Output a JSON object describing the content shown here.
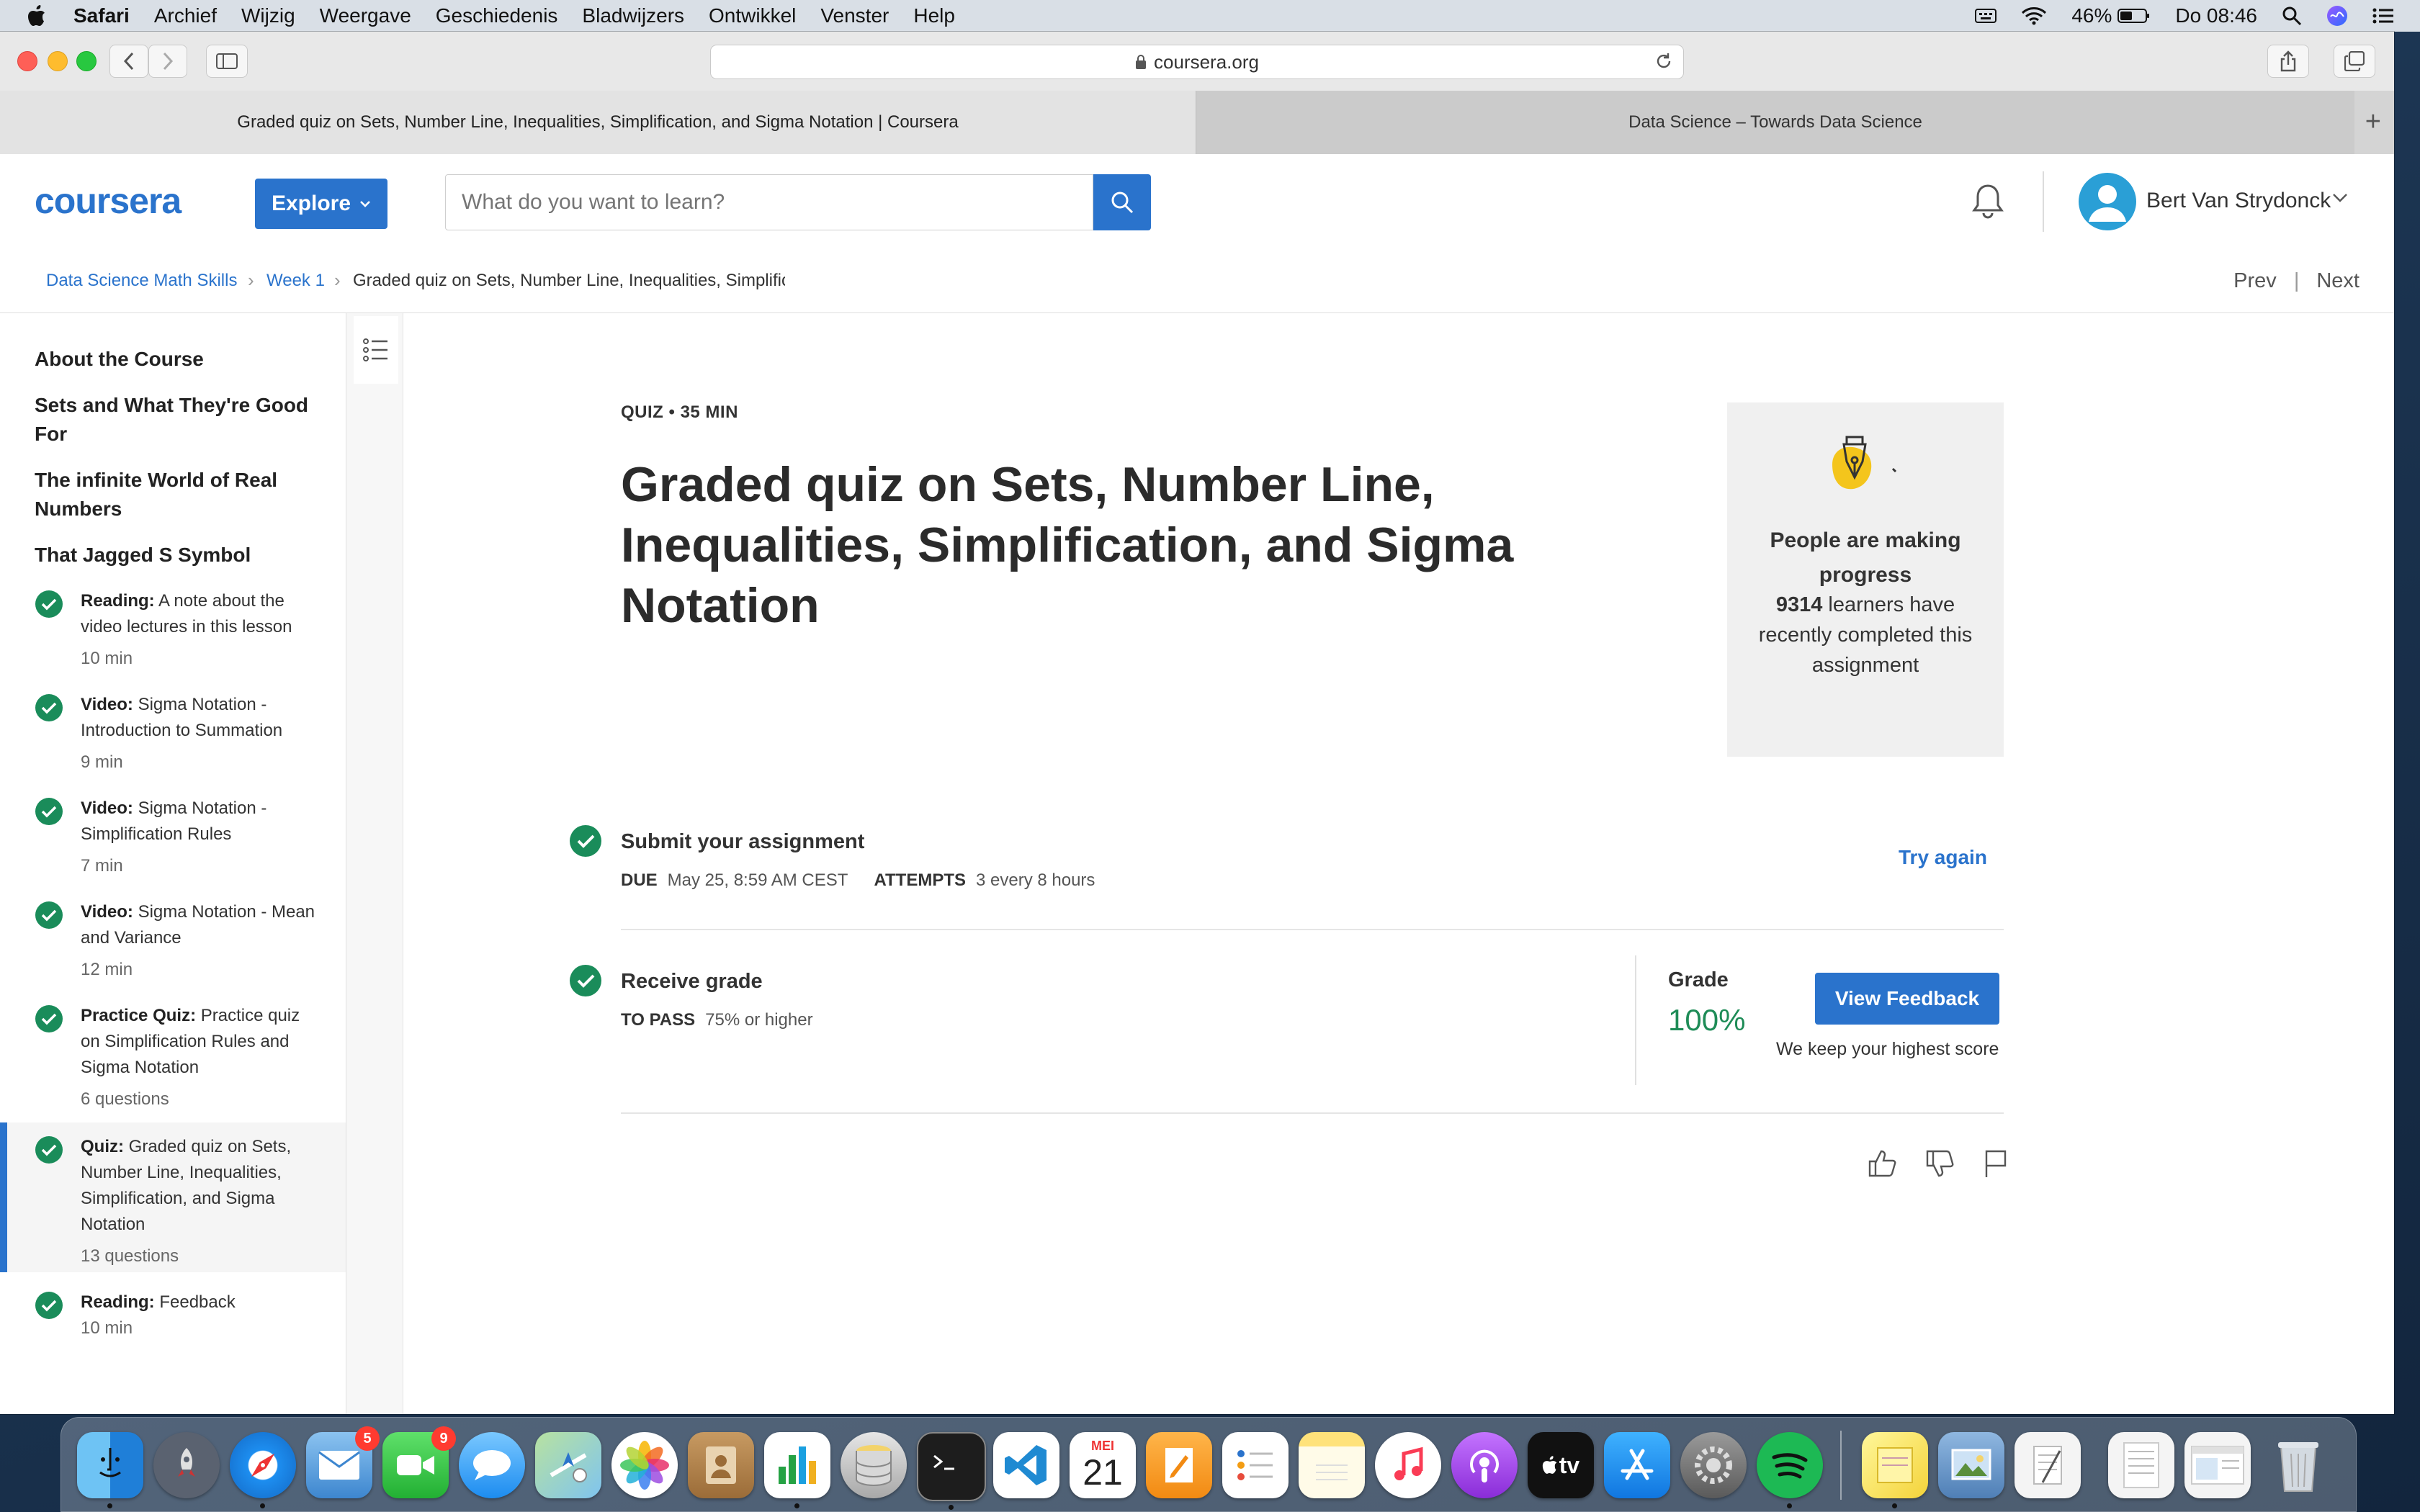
{
  "menubar": {
    "items": [
      "Safari",
      "Archief",
      "Wijzig",
      "Weergave",
      "Geschiedenis",
      "Bladwijzers",
      "Ontwikkel",
      "Venster",
      "Help"
    ],
    "battery": "46%",
    "clock": "Do 08:46"
  },
  "browser": {
    "url": "coursera.org",
    "tabs": [
      {
        "title": "Graded quiz on Sets, Number Line, Inequalities, Simplification, and Sigma Notation | Coursera",
        "active": true
      },
      {
        "title": "Data Science – Towards Data Science",
        "active": false
      }
    ]
  },
  "header": {
    "logo_text": "coursera",
    "explore_label": "Explore",
    "search_placeholder": "What do you want to learn?",
    "username": "Bert Van Strydonck"
  },
  "breadcrumb": {
    "course": "Data Science Math Skills",
    "week": "Week 1",
    "current": "Graded quiz on Sets, Number Line, Inequalities, Simplification, and Sigma Notation",
    "prev": "Prev",
    "next": "Next"
  },
  "sidebar": {
    "headings": [
      "About the Course",
      "Sets and What They're Good For",
      "The infinite World of Real Numbers",
      "That Jagged S Symbol"
    ],
    "items": [
      {
        "type": "Reading:",
        "title": "A note about the video lectures in this lesson",
        "meta": "10 min"
      },
      {
        "type": "Video:",
        "title": "Sigma Notation - Introduction to Summation",
        "meta": "9 min"
      },
      {
        "type": "Video:",
        "title": "Sigma Notation - Simplification Rules",
        "meta": "7 min"
      },
      {
        "type": "Video:",
        "title": "Sigma Notation - Mean and Variance",
        "meta": "12 min"
      },
      {
        "type": "Practice Quiz:",
        "title": "Practice quiz on Simplification Rules and Sigma Notation",
        "meta": "6 questions"
      },
      {
        "type": "Quiz:",
        "title": "Graded quiz on Sets, Number Line, Inequalities, Simplification, and Sigma Notation",
        "meta": "13 questions"
      },
      {
        "type": "Reading:",
        "title": "Feedback",
        "meta": "10 min"
      }
    ]
  },
  "main": {
    "type_label": "QUIZ • 35 MIN",
    "title": "Graded quiz on Sets, Number Line, Inequalities, Simplification, and Sigma Notation",
    "progress_card": {
      "title": "People are making progress",
      "count": "9314",
      "text": "learners have recently completed this assignment"
    },
    "submit": {
      "title": "Submit your assignment",
      "due_label": "DUE",
      "due_value": "May 25, 8:59 AM CEST",
      "attempts_label": "ATTEMPTS",
      "attempts_value": "3 every 8 hours",
      "try_again": "Try again"
    },
    "receive": {
      "title": "Receive grade",
      "pass_label": "TO PASS",
      "pass_value": "75% or higher",
      "grade_label": "Grade",
      "grade_value": "100%",
      "view_feedback": "View Feedback",
      "keep_note": "We keep your highest score"
    }
  },
  "dock": {
    "apps": [
      "Finder",
      "Launchpad",
      "Safari",
      "Mail",
      "FaceTime",
      "Messages",
      "Maps",
      "Photos",
      "Contacts",
      "Numbers",
      "Sequel",
      "Terminal",
      "Visual Studio Code",
      "Calendar",
      "Pages",
      "Reminders",
      "Notes",
      "Music",
      "Podcasts",
      "TV",
      "App Store",
      "System Preferences",
      "Spotify",
      "Stickies",
      "Preview",
      "TextEdit",
      "Document",
      "Window",
      "Trash"
    ],
    "mail_badge": "5",
    "facetime_badge": "9",
    "calendar_month": "MEI",
    "calendar_day": "21",
    "tv_label": "tv"
  },
  "colors": {
    "accent": "#2a73cc",
    "success": "#1e8c57",
    "check": "#1a8c5a"
  }
}
